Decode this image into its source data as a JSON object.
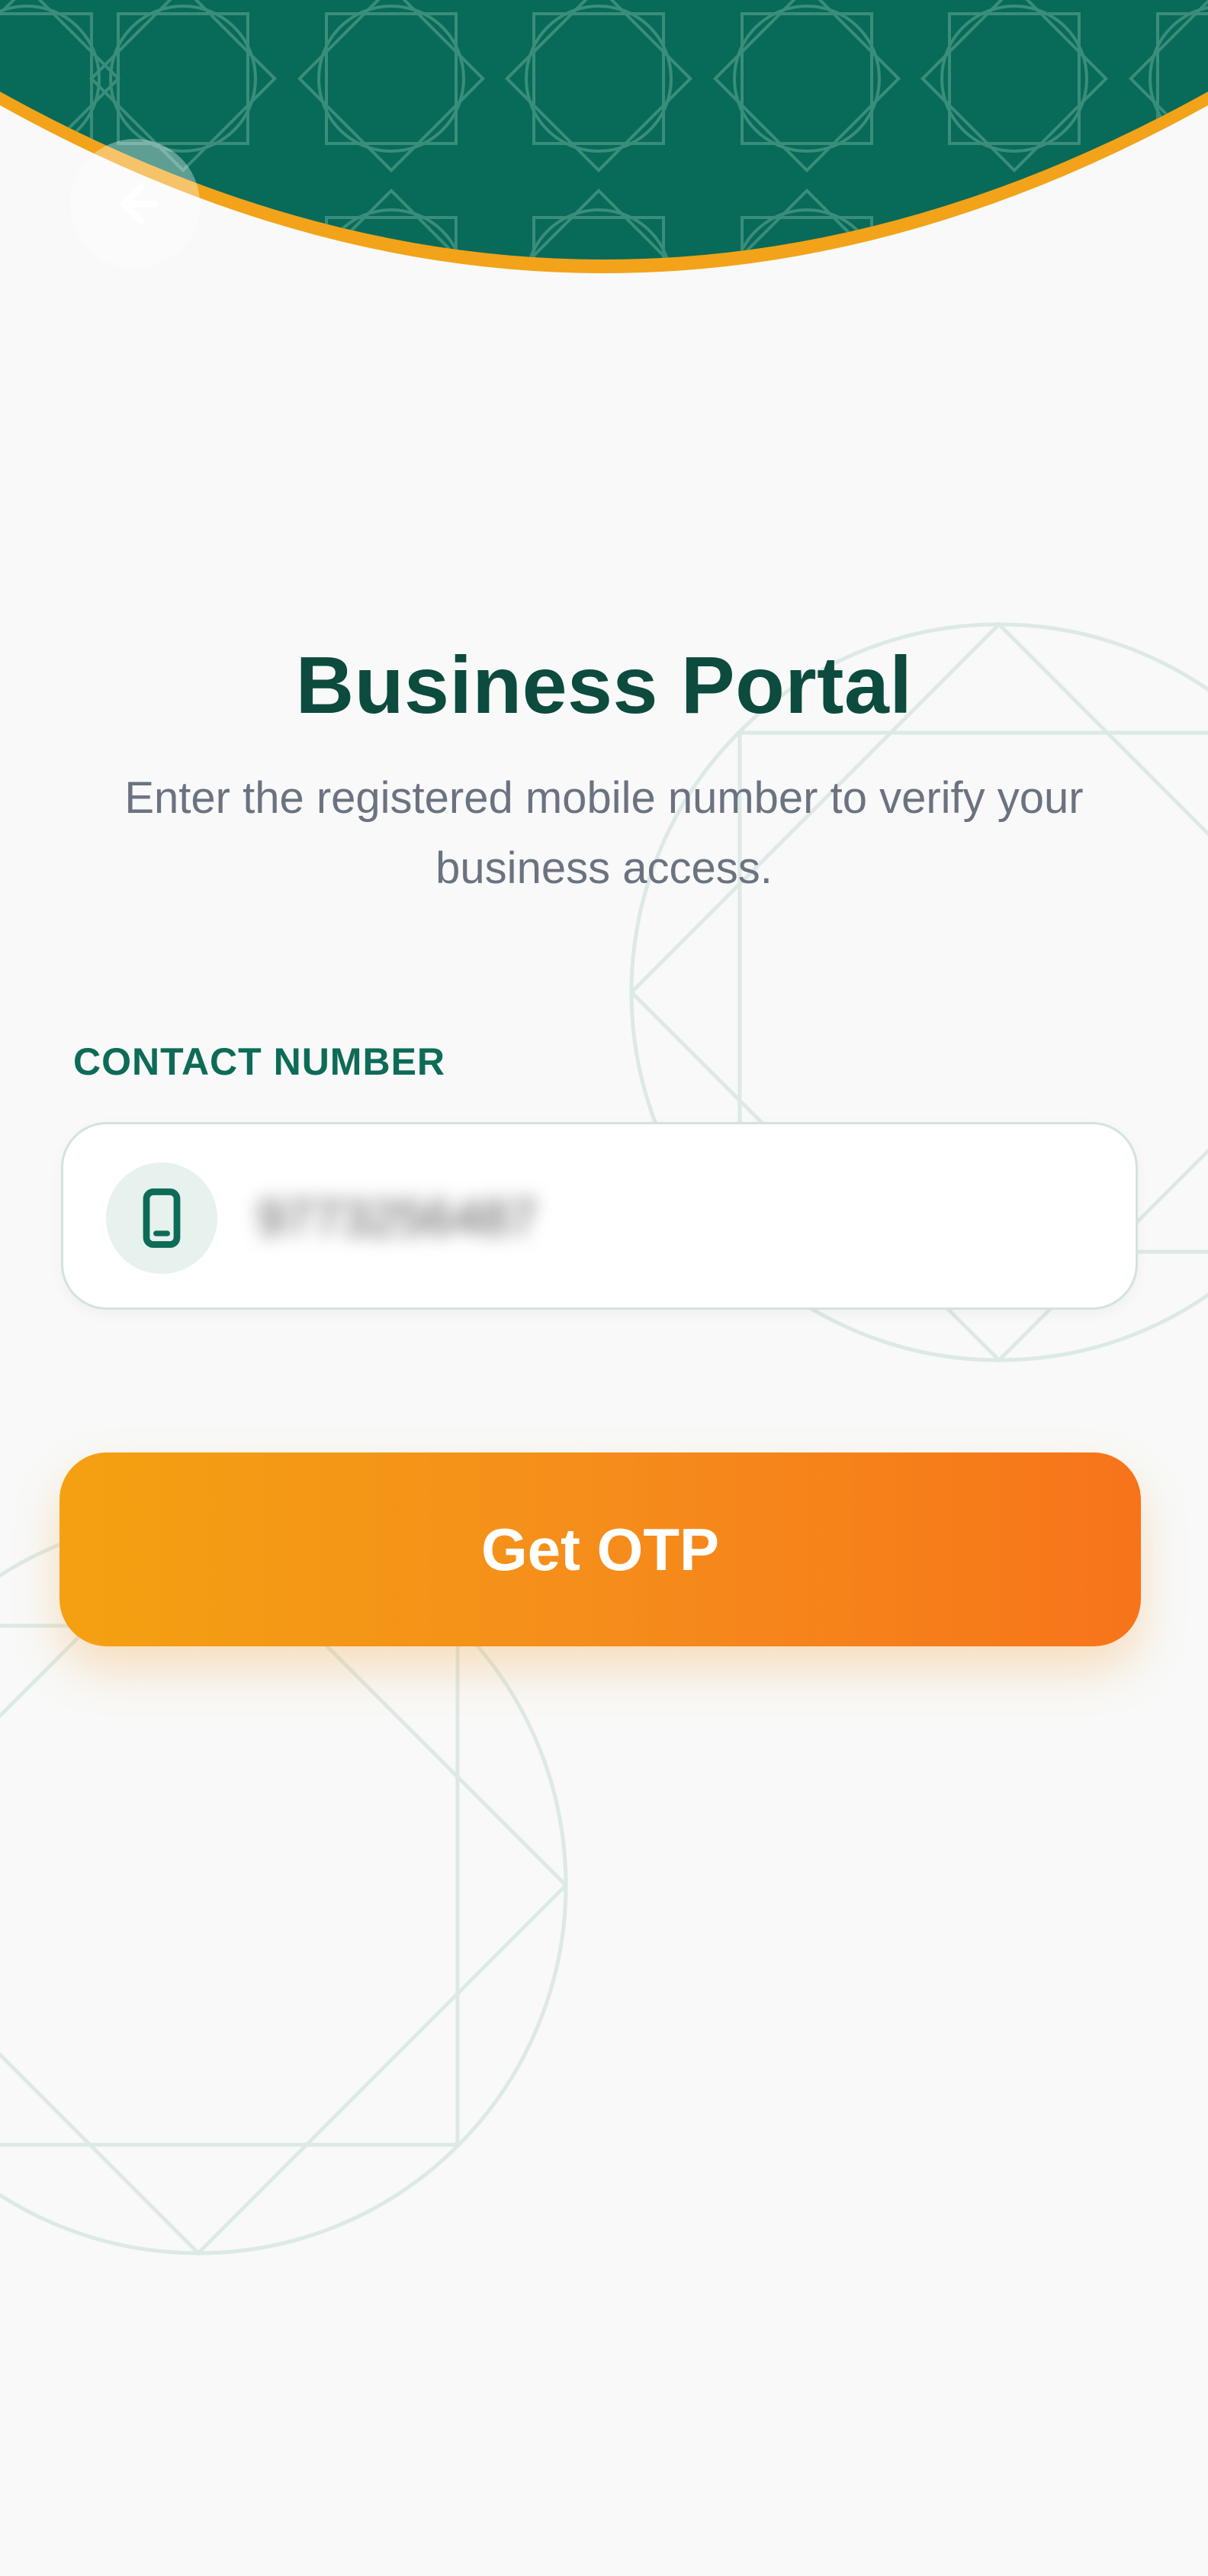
{
  "header": {
    "back_icon": "back-arrow-icon"
  },
  "main": {
    "title": "Business Portal",
    "subtitle": "Enter the registered mobile number to verify your business access."
  },
  "form": {
    "contact_label": "CONTACT NUMBER",
    "phone_icon": "mobile-phone-icon",
    "phone_value": "9773256487",
    "submit_label": "Get OTP"
  },
  "colors": {
    "brand_green": "#086a59",
    "title_green": "#0c4b3d",
    "accent_orange": "#f4a111",
    "button_end": "#f7741a",
    "background": "#f8f9f8"
  }
}
